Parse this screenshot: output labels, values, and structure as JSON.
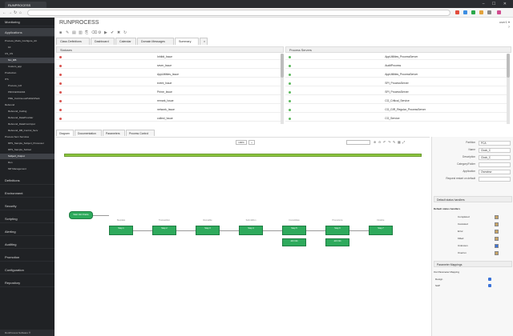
{
  "browser": {
    "tab_title": "RUNPROCESS",
    "window_controls": "– ☐ ✕",
    "nav": {
      "back": "←",
      "forward": "→",
      "reload": "↻",
      "home": "⌂"
    },
    "ext_colors": [
      "#e24c3c",
      "#3b8de2",
      "#2aa84a",
      "#e2a23c",
      "#8a8a8a",
      "#d14b8f"
    ]
  },
  "sidebar": {
    "items": [
      {
        "label": "Monitoring",
        "selected": false
      },
      {
        "label": "Applications",
        "selected": true
      }
    ],
    "tree": [
      {
        "label": "Process_Mods_Configure_Att",
        "level": 1,
        "selected": false
      },
      {
        "label": "10",
        "level": 2,
        "selected": false
      },
      {
        "label": "CS_CS",
        "level": 1,
        "selected": false
      },
      {
        "label": "Srv_RB",
        "level": 2,
        "selected": true
      },
      {
        "label": "Custom_app",
        "level": 2,
        "selected": false
      },
      {
        "label": "Production",
        "level": 1,
        "selected": false
      },
      {
        "label": "ITS",
        "level": 1,
        "selected": false
      },
      {
        "label": "Process_GO",
        "level": 2,
        "selected": false
      },
      {
        "label": "PROCESS1004",
        "level": 2,
        "selected": false
      },
      {
        "label": "PRE_ContinuousPublishPack",
        "level": 2,
        "selected": false
      },
      {
        "label": "Rebound",
        "level": 1,
        "selected": false
      },
      {
        "label": "Rebound_Coding",
        "level": 2,
        "selected": false
      },
      {
        "label": "Rebound_DataProvider",
        "level": 2,
        "selected": false
      },
      {
        "label": "Rebound_DataFromInput",
        "level": 2,
        "selected": false
      },
      {
        "label": "Rebound_DB_Control_Serv",
        "level": 2,
        "selected": false
      },
      {
        "label": "Process Serv Services",
        "level": 1,
        "selected": false
      },
      {
        "label": "RPS_Sample_Subject_Processor",
        "level": 2,
        "selected": false
      },
      {
        "label": "RPS_Sample_Subset",
        "level": 2,
        "selected": false
      },
      {
        "label": "Subject_Output",
        "level": 2,
        "selected": true
      },
      {
        "label": "Run",
        "level": 2,
        "selected": false
      },
      {
        "label": "MP Management",
        "level": 2,
        "selected": false
      }
    ],
    "sections": [
      "Definitions",
      "Environment",
      "Security",
      "Scripting",
      "Alerting",
      "Auditing",
      "Promotion",
      "Configuration",
      "Repository"
    ],
    "footer": "RunProcess Software ®"
  },
  "header": {
    "title": "RUNPROCESS",
    "user": "user1 ▾",
    "help": "?",
    "toolbar_icons": [
      "■",
      "✎",
      "▤",
      "▥",
      "⎘",
      "⌫",
      "⚙",
      "▶",
      "✔",
      "✖",
      "↻"
    ]
  },
  "doc_tabs": [
    "Class Definitions",
    "Dashboard",
    "Calendar",
    "Domain Messages",
    "Summary"
  ],
  "statuses": {
    "header": "Statuses",
    "items": [
      {
        "label": "Inhibit_Issue",
        "color": "#d9534f"
      },
      {
        "label": "sevm_Issue",
        "color": "#d9534f"
      },
      {
        "label": "AppUtilities_Issue",
        "color": "#d9534f"
      },
      {
        "label": "event_Issue",
        "color": "#d9534f"
      },
      {
        "label": "Prime_Issue",
        "color": "#d9534f"
      },
      {
        "label": "remark_Issue",
        "color": "#d9534f"
      },
      {
        "label": "network_Issue",
        "color": "#d9534f"
      },
      {
        "label": "collect_Issue",
        "color": "#d9534f"
      }
    ]
  },
  "process_servers": {
    "header": "Process Servers",
    "items": [
      {
        "label": "AppUtilities_ProcessServer",
        "color": "#5cb85c"
      },
      {
        "label": "AuditProcess",
        "color": "#5cb85c"
      },
      {
        "label": "AppUtilities_ProcessServer",
        "color": "#5cb85c"
      },
      {
        "label": "SPI_ProcessServer",
        "color": "#5cb85c"
      },
      {
        "label": "SPI_ProcessServer",
        "color": "#5cb85c"
      },
      {
        "label": "CG_Critical_Service",
        "color": "#5cb85c"
      },
      {
        "label": "CG_GIR_Regular_ProcessServer",
        "color": "#5cb85c"
      },
      {
        "label": "CG_Service",
        "color": "#5cb85c"
      }
    ]
  },
  "sub_tabs": [
    "Diagram",
    "Documentation",
    "Parameters",
    "Process Control"
  ],
  "diagram": {
    "zoom": "100%",
    "start": {
      "label": "Start Job Chains"
    },
    "steps": [
      {
        "label": "Step 1",
        "caption": "Job Info"
      },
      {
        "label": "Step 2",
        "caption": "Job Info"
      },
      {
        "label": "Step 3",
        "caption": "Job Info"
      },
      {
        "label": "Step 4",
        "caption": "Job Info"
      },
      {
        "label": "Step 5",
        "caption": "Job Info"
      },
      {
        "label": "Step 6",
        "caption": "Job Info"
      },
      {
        "label": "Step 7",
        "caption": "Job Info"
      }
    ],
    "step_labels": [
      "Stepdate",
      "Transacttion",
      "Runnable",
      "SubmitRun",
      "Consolidate",
      "Promotions",
      "Finalize"
    ]
  },
  "properties": {
    "fields": [
      {
        "label": "Partition",
        "value": "PCA"
      },
      {
        "label": "Name",
        "value": "Clock_C"
      },
      {
        "label": "Description",
        "value": "Clock_C"
      },
      {
        "label": "Category/Folder",
        "value": ""
      },
      {
        "label": "Application",
        "value": "Overview"
      },
      {
        "label": "Request restart on default",
        "value": ""
      }
    ],
    "default_status_handlers": "Default status handlers",
    "default_handler_head": "Default status handlers",
    "handlers": [
      {
        "label": "Completed",
        "color": "#c8a464"
      },
      {
        "label": "Canceled",
        "color": "#c8a464"
      },
      {
        "label": "Error",
        "color": "#c8a464"
      },
      {
        "label": "Killed",
        "color": "#c8a464"
      },
      {
        "label": "Unknown",
        "color": "#3b73d9"
      },
      {
        "label": "Overrun",
        "color": "#c8a464"
      }
    ],
    "param_mappings_head": "Parameter Mappings",
    "param_mappings_sub": "Out Parameter Mapping",
    "mappings": [
      {
        "label": "Design",
        "checked": true
      },
      {
        "label": "SAP",
        "checked": true
      }
    ]
  }
}
